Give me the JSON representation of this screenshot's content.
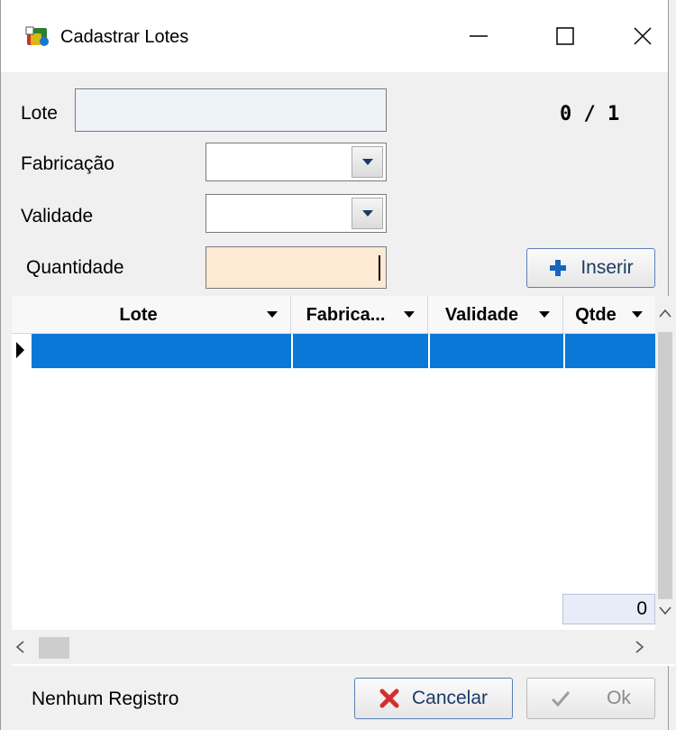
{
  "window": {
    "title": "Cadastrar Lotes",
    "controls": {
      "minimize": "—",
      "maximize": "☐",
      "close": "✕"
    }
  },
  "form": {
    "lote_label": "Lote",
    "lote_value": "",
    "counter": "0 / 1",
    "fabricacao_label": "Fabricação",
    "fabricacao_value": "",
    "validade_label": "Validade",
    "validade_value": "",
    "quantidade_label": "Quantidade",
    "quantidade_value": ""
  },
  "buttons": {
    "inserir": "Inserir",
    "cancelar": "Cancelar",
    "ok": "Ok"
  },
  "grid": {
    "columns": [
      "Lote",
      "Fabrica...",
      "Validade",
      "Qtde"
    ],
    "rows": [
      [
        "",
        "",
        "",
        ""
      ]
    ],
    "footer_total": "0"
  },
  "status_text": "Nenhum Registro",
  "colors": {
    "selection": "#0a78d7",
    "quantity_field": "#fde9d4",
    "insert_icon": "#1565c0",
    "cancel_icon": "#d32f2f"
  },
  "icons": [
    "app-icon",
    "chevron-down-icon",
    "plus-icon",
    "x-icon",
    "check-icon"
  ]
}
